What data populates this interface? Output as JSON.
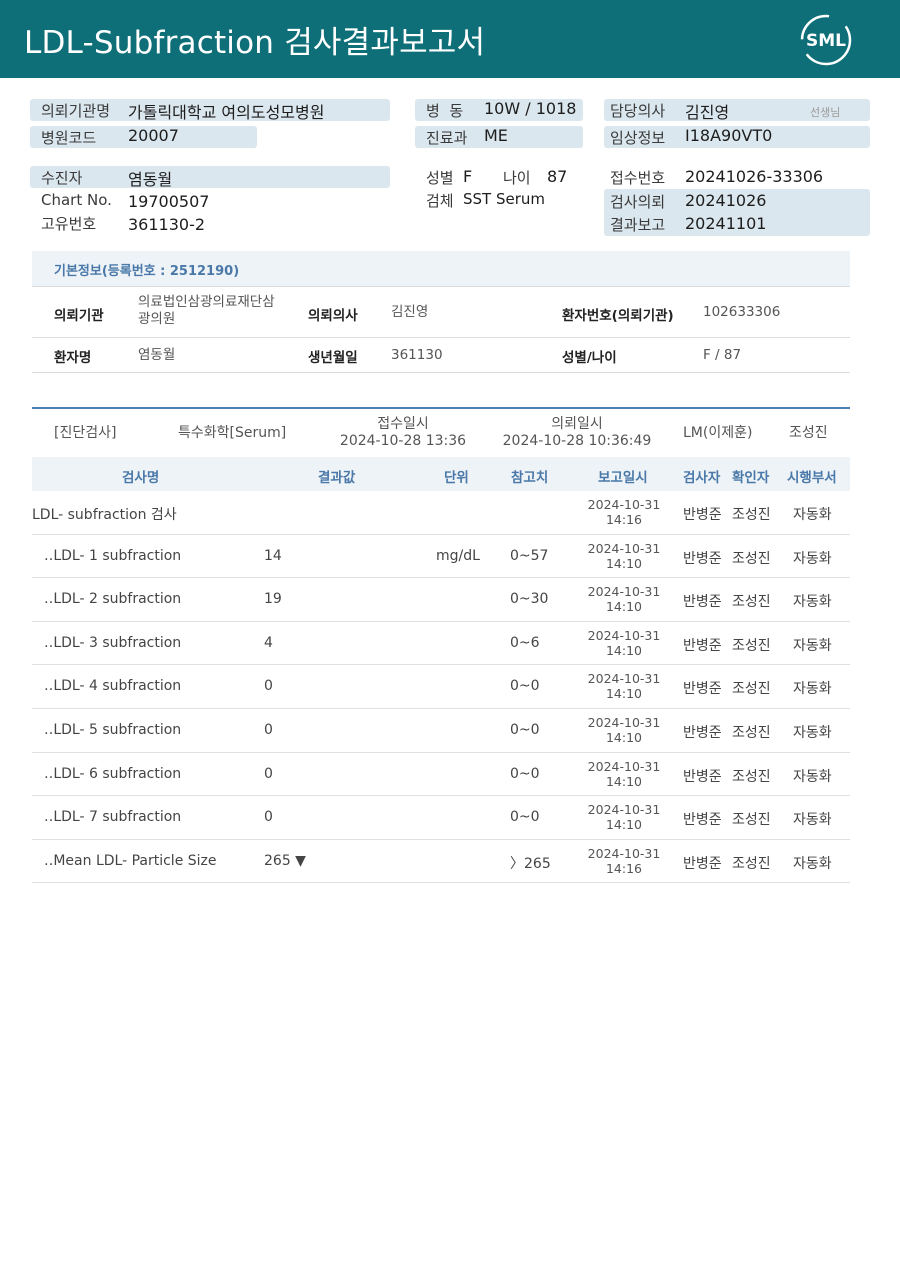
{
  "header": {
    "title": "LDL-Subfraction 검사결과보고서",
    "logo_text": "SML"
  },
  "patient_info": {
    "institution_label": "의뢰기관명",
    "institution": "가톨릭대학교 여의도성모병원",
    "hospital_code_label": "병원코드",
    "hospital_code": "20007",
    "ward_label": "병  동",
    "ward": "10W / 1018",
    "dept_label": "진료과",
    "dept": "ME",
    "doctor_label": "담당의사",
    "doctor": "김진영",
    "doctor_suffix": "선생님",
    "clinical_label": "임상정보",
    "clinical": "I18A90VT0",
    "patient_label": "수진자",
    "patient": "염동월",
    "chart_label": "Chart No.",
    "chart": "19700507",
    "unique_label": "고유번호",
    "unique": "361130-2",
    "sex_label": "성별",
    "sex": "F",
    "age_label": "나이",
    "age": "87",
    "specimen_label": "검체",
    "specimen": "SST Serum",
    "receipt_label": "접수번호",
    "receipt": "20241026-33306",
    "request_label": "검사의뢰",
    "request": "20241026",
    "report_label": "결과보고",
    "report": "20241101"
  },
  "basic_info": {
    "title": "기본정보(등록번호 : 2512190)",
    "inst_key": "의뢰기관",
    "inst_val_1": "의료법인삼광의료재단삼",
    "inst_val_2": "광의원",
    "doc_key": "의뢰의사",
    "doc_val": "김진영",
    "pno_key": "환자번호(의뢰기관)",
    "pno_val": "102633306",
    "name_key": "환자명",
    "name_val": "염동월",
    "birth_key": "생년월일",
    "birth_val": "361130",
    "sexage_key": "성별/나이",
    "sexage_val": "F / 87"
  },
  "order": {
    "category": "[진단검사]",
    "section": "특수화학[Serum]",
    "received_label": "접수일시",
    "received": "2024-10-28 13:36",
    "requested_label": "의뢰일시",
    "requested": "2024-10-28 10:36:49",
    "lm": "LM(이제훈)",
    "confirmer": "조성진"
  },
  "table": {
    "headers": [
      "검사명",
      "결과값",
      "단위",
      "참고치",
      "보고일시",
      "검사자",
      "확인자",
      "시행부서"
    ],
    "rows": [
      {
        "name": "LDL- subfraction 검사",
        "value": "",
        "unit": "",
        "ref": "",
        "date": "2024-10-31",
        "time": "14:16",
        "tester": "반병준",
        "confirmer": "조성진",
        "dept": "자동화"
      },
      {
        "name": "‥LDL- 1 subfraction",
        "value": "14",
        "unit": "mg/dL",
        "ref": "0~57",
        "date": "2024-10-31",
        "time": "14:10",
        "tester": "반병준",
        "confirmer": "조성진",
        "dept": "자동화"
      },
      {
        "name": "‥LDL- 2 subfraction",
        "value": "19",
        "unit": "",
        "ref": "0~30",
        "date": "2024-10-31",
        "time": "14:10",
        "tester": "반병준",
        "confirmer": "조성진",
        "dept": "자동화"
      },
      {
        "name": "‥LDL- 3 subfraction",
        "value": "4",
        "unit": "",
        "ref": "0~6",
        "date": "2024-10-31",
        "time": "14:10",
        "tester": "반병준",
        "confirmer": "조성진",
        "dept": "자동화"
      },
      {
        "name": "‥LDL- 4 subfraction",
        "value": "0",
        "unit": "",
        "ref": "0~0",
        "date": "2024-10-31",
        "time": "14:10",
        "tester": "반병준",
        "confirmer": "조성진",
        "dept": "자동화"
      },
      {
        "name": "‥LDL- 5 subfraction",
        "value": "0",
        "unit": "",
        "ref": "0~0",
        "date": "2024-10-31",
        "time": "14:10",
        "tester": "반병준",
        "confirmer": "조성진",
        "dept": "자동화"
      },
      {
        "name": "‥LDL- 6 subfraction",
        "value": "0",
        "unit": "",
        "ref": "0~0",
        "date": "2024-10-31",
        "time": "14:10",
        "tester": "반병준",
        "confirmer": "조성진",
        "dept": "자동화"
      },
      {
        "name": "‥LDL- 7 subfraction",
        "value": "0",
        "unit": "",
        "ref": "0~0",
        "date": "2024-10-31",
        "time": "14:10",
        "tester": "반병준",
        "confirmer": "조성진",
        "dept": "자동화"
      },
      {
        "name": "‥Mean LDL- Particle Size",
        "value": "265 ▼",
        "unit": "",
        "ref": "〉265",
        "date": "2024-10-31",
        "time": "14:16",
        "tester": "반병준",
        "confirmer": "조성진",
        "dept": "자동화"
      }
    ]
  }
}
